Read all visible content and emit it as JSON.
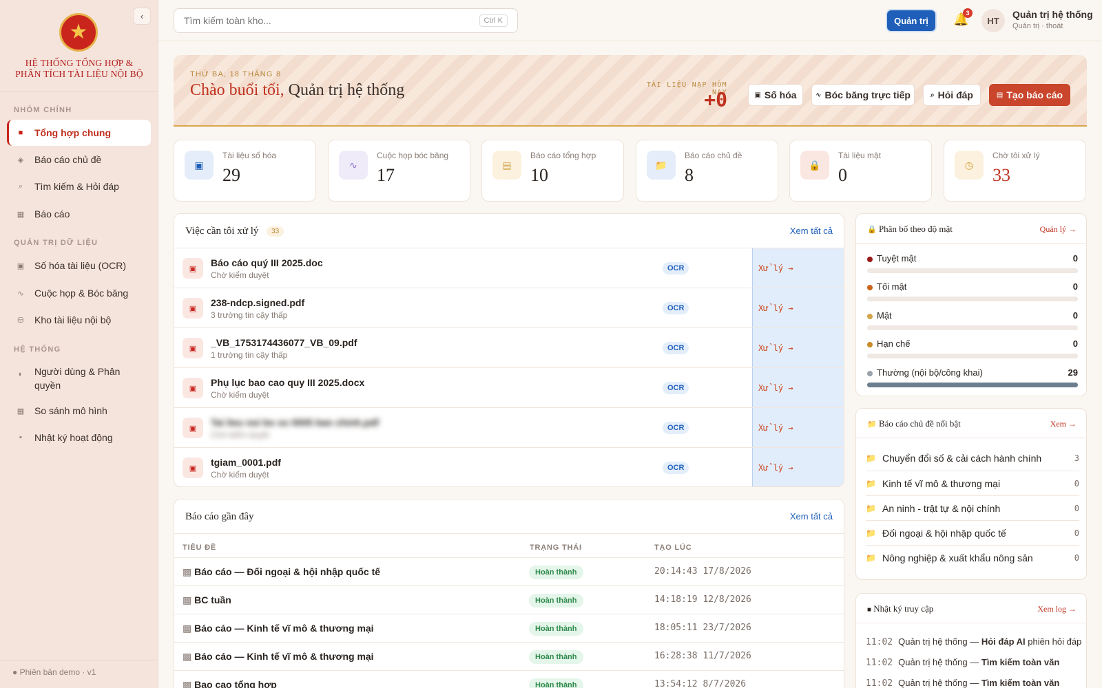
{
  "sidebar": {
    "collapse_icon": "‹",
    "brand_line1": "HỆ THỐNG TỔNG HỢP &",
    "brand_line2": "PHÂN TÍCH TÀI LIỆU NỘI BỘ",
    "sections": [
      "NHÓM CHÍNH",
      "QUẢN TRỊ DỮ LIỆU",
      "HỆ THỐNG"
    ],
    "items": [
      {
        "label": "Tổng hợp chung",
        "icon": "■"
      },
      {
        "label": "Báo cáo chủ đề",
        "icon": "◈"
      },
      {
        "label": "Tìm kiếm & Hỏi đáp",
        "icon": "⌕"
      },
      {
        "label": "Báo cáo",
        "icon": "▦"
      },
      {
        "label": "Số hóa tài liệu (OCR)",
        "icon": "▣"
      },
      {
        "label": "Cuộc họp & Bóc băng",
        "icon": "∿"
      },
      {
        "label": "Kho tài liệu nội bộ",
        "icon": "⛁"
      },
      {
        "label": "Người dùng & Phân quyền",
        "icon": "◐"
      },
      {
        "label": "So sánh mô hình",
        "icon": "▦"
      },
      {
        "label": "Nhật ký hoạt động",
        "icon": "▪"
      }
    ],
    "footer": "Phiên bản demo · v1"
  },
  "topbar": {
    "search_placeholder": "Tìm kiếm toàn kho...",
    "shortcut": "Ctrl K",
    "admin_label": "Quản trị",
    "notif_count": "3",
    "avatar_initials": "HT",
    "user_name": "Quản trị hệ thống",
    "user_sub": "Quản trị · thoát"
  },
  "banner": {
    "date": "THỨ BA, 18 THÁNG 8",
    "greeting": "Chào buổi tối,",
    "name": "Quản trị hệ thống",
    "today_label": "TÀI LIỆU NẠP HÔM NAY",
    "today_count": "+0",
    "buttons": [
      {
        "label": "Số hóa",
        "icon": "▣"
      },
      {
        "label": "Bóc băng trực tiếp",
        "icon": "∿"
      },
      {
        "label": "Hỏi đáp",
        "icon": "⌕"
      },
      {
        "label": "Tạo báo cáo",
        "icon": "▤"
      }
    ]
  },
  "stats": [
    {
      "label": "Tài liệu số hóa",
      "value": "29",
      "icon": "▣",
      "icon_color": "#1f5fb9",
      "bg": "#e4edf9"
    },
    {
      "label": "Cuộc họp bóc băng",
      "value": "17",
      "icon": "∿",
      "icon_color": "#8a6fc9",
      "bg": "#f0ebf9"
    },
    {
      "label": "Báo cáo tổng hợp",
      "value": "10",
      "icon": "▤",
      "icon_color": "#d4a64a",
      "bg": "#fbf1de"
    },
    {
      "label": "Báo cáo chủ đề",
      "value": "8",
      "icon": "📁",
      "icon_color": "#5a6f8a",
      "bg": "#e4edf9"
    },
    {
      "label": "Tài liệu mật",
      "value": "0",
      "icon": "🔒",
      "icon_color": "#c9251d",
      "bg": "#fbe7e2"
    },
    {
      "label": "Chờ tôi xử lý",
      "value": "33",
      "icon": "◷",
      "icon_color": "#d49a2a",
      "bg": "#fbf1de",
      "accent": "#c0311f"
    }
  ],
  "todo": {
    "title": "Việc cần tôi xử lý",
    "count": "33",
    "view_all": "Xem tất cả",
    "rows": [
      {
        "name": "Báo cáo quý III 2025.doc",
        "sub": "Chờ kiểm duyệt",
        "tag": "OCR",
        "action": "Xử lý →"
      },
      {
        "name": "238-ndcp.signed.pdf",
        "sub": "3 trường tin cậy thấp",
        "tag": "OCR",
        "action": "Xử lý →"
      },
      {
        "name": "_VB_1753174436077_VB_09.pdf",
        "sub": "1 trường tin cậy thấp",
        "tag": "OCR",
        "action": "Xử lý →"
      },
      {
        "name": "Phụ lục bao cao quy III 2025.docx",
        "sub": "Chờ kiểm duyệt",
        "tag": "OCR",
        "action": "Xử lý →"
      },
      {
        "name": "Tai lieu noi bo so 0005 ban chinh.pdf",
        "sub": "Chờ kiểm duyệt",
        "tag": "OCR",
        "action": "Xử lý →",
        "blurred": true
      },
      {
        "name": "tgiam_0001.pdf",
        "sub": "Chờ kiểm duyệt",
        "tag": "OCR",
        "action": "Xử lý →"
      }
    ]
  },
  "reports": {
    "title": "Báo cáo gần đây",
    "view_all": "Xem tất cả",
    "col_title": "TIÊU ĐỀ",
    "col_status": "TRẠNG THÁI",
    "col_created": "TẠO LÚC",
    "rows": [
      {
        "title": "Báo cáo — Đối ngoại & hội nhập quốc tế",
        "status": "Hoàn thành",
        "created": "20:14:43 17/8/2026"
      },
      {
        "title": "BC tuần",
        "status": "Hoàn thành",
        "created": "14:18:19 12/8/2026"
      },
      {
        "title": "Báo cáo — Kinh tế vĩ mô & thương mại",
        "status": "Hoàn thành",
        "created": "18:05:11 23/7/2026"
      },
      {
        "title": "Báo cáo — Kinh tế vĩ mô & thương mại",
        "status": "Hoàn thành",
        "created": "16:28:38 11/7/2026"
      },
      {
        "title": "Bao cao tổng hợp",
        "status": "Hoàn thành",
        "created": "13:54:12 8/7/2026"
      }
    ]
  },
  "distribution": {
    "title": "Phân bố theo độ mật",
    "link": "Quản lý →",
    "rows": [
      {
        "name": "Tuyệt mật",
        "value": "0",
        "fraction": 0,
        "color": "#9a1a1a"
      },
      {
        "name": "Tối mật",
        "value": "0",
        "fraction": 0,
        "color": "#c9651d"
      },
      {
        "name": "Mật",
        "value": "0",
        "fraction": 0,
        "color": "#d4a64a"
      },
      {
        "name": "Hạn chế",
        "value": "0",
        "fraction": 0,
        "color": "#c98a2a"
      },
      {
        "name": "Thường (nội bộ/công khai)",
        "value": "29",
        "fraction": 1,
        "color": "#9aa3ab"
      }
    ]
  },
  "topics": {
    "title": "Báo cáo chủ đề nổi bật",
    "link": "Xem →",
    "rows": [
      {
        "name": "Chuyển đổi số & cải cách hành chính",
        "count": "3"
      },
      {
        "name": "Kinh tế vĩ mô & thương mại",
        "count": "0"
      },
      {
        "name": "An ninh - trật tự & nội chính",
        "count": "0"
      },
      {
        "name": "Đối ngoại & hội nhập quốc tế",
        "count": "0"
      },
      {
        "name": "Nông nghiệp & xuất khẩu nông sản",
        "count": "0"
      }
    ]
  },
  "access_log": {
    "title": "Nhật ký truy cập",
    "link": "Xem log →",
    "rows": [
      {
        "time": "11:02",
        "user": "Quản trị hệ thống —",
        "action": "Hỏi đáp AI",
        "detail": "phiên hỏi đáp"
      },
      {
        "time": "11:02",
        "user": "Quản trị hệ thống —",
        "action": "Tìm kiếm toàn văn",
        "detail": ""
      },
      {
        "time": "11:02",
        "user": "Quản trị hệ thống —",
        "action": "Tìm kiếm toàn văn",
        "detail": ""
      }
    ]
  }
}
